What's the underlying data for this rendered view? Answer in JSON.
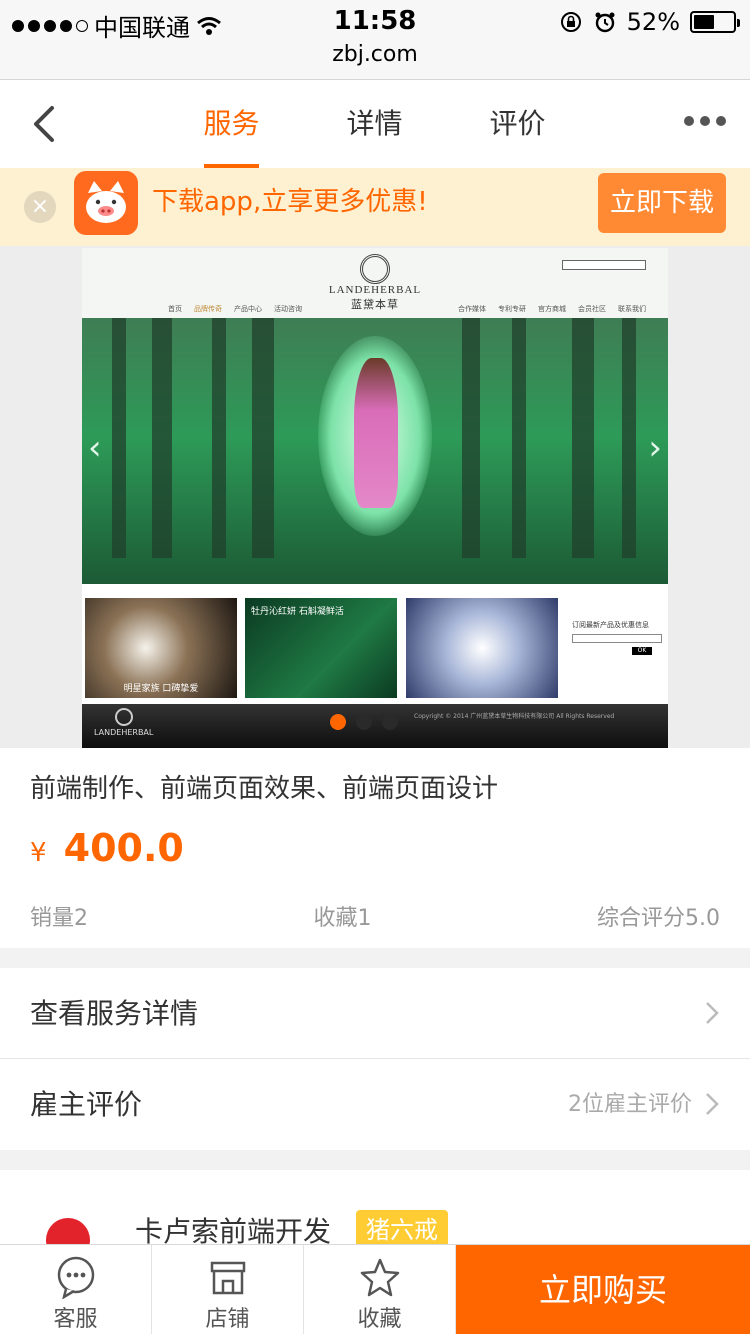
{
  "status_bar": {
    "carrier": "中国联通",
    "time": "11:58",
    "battery_percent": "52%",
    "battery_level": 0.52,
    "url": "zbj.com"
  },
  "nav": {
    "tabs": [
      "服务",
      "详情",
      "评价"
    ],
    "active_tab": 0
  },
  "promo": {
    "text": "下载app,立享更多优惠!",
    "button": "立即下载"
  },
  "banner": {
    "brand": "LANDEHERBAL",
    "brand_cn": "蓝黛本草",
    "menu_left": [
      "首页",
      "品牌传奇",
      "产品中心",
      "活动咨询"
    ],
    "menu_right": [
      "合作媒体",
      "专利专研",
      "官方商城",
      "会员社区",
      "联系我们"
    ],
    "thumb1_caption": "明星家族  口碑挚爱",
    "thumb2_caption": "牡丹沁红妍 石斛凝鲜活",
    "subscribe_title": "订阅最新产品及优惠信息",
    "subscribe_ok": "OK",
    "footer_copy": "Copyright © 2014 广州蓝黛本草生物科技有限公司 All Rights Reserved",
    "active_slide": 0,
    "slide_count": 3
  },
  "product": {
    "title": "前端制作、前端页面效果、前端页面设计",
    "currency": "¥",
    "price": "400.0",
    "sales": "销量2",
    "favorites": "收藏1",
    "rating": "综合评分5.0"
  },
  "rows": {
    "details_label": "查看服务详情",
    "reviews_label": "雇主评价",
    "reviews_count": "2位雇主评价"
  },
  "seller": {
    "name": "卡卢索前端开发",
    "badge": "猪六戒"
  },
  "tabbar": {
    "service": "客服",
    "shop": "店铺",
    "favorite": "收藏",
    "buy": "立即购买"
  },
  "colors": {
    "accent": "#ff6600",
    "promo_bg": "#fdf1d2",
    "badge": "#ffcc33"
  },
  "icons": [
    "signal-dots-icon",
    "wifi-icon",
    "rotation-lock-icon",
    "alarm-icon",
    "battery-icon",
    "back-arrow-icon",
    "more-dots-icon",
    "close-icon",
    "pig-logo-icon",
    "chevron-right-icon",
    "chat-icon",
    "store-icon",
    "star-icon"
  ]
}
